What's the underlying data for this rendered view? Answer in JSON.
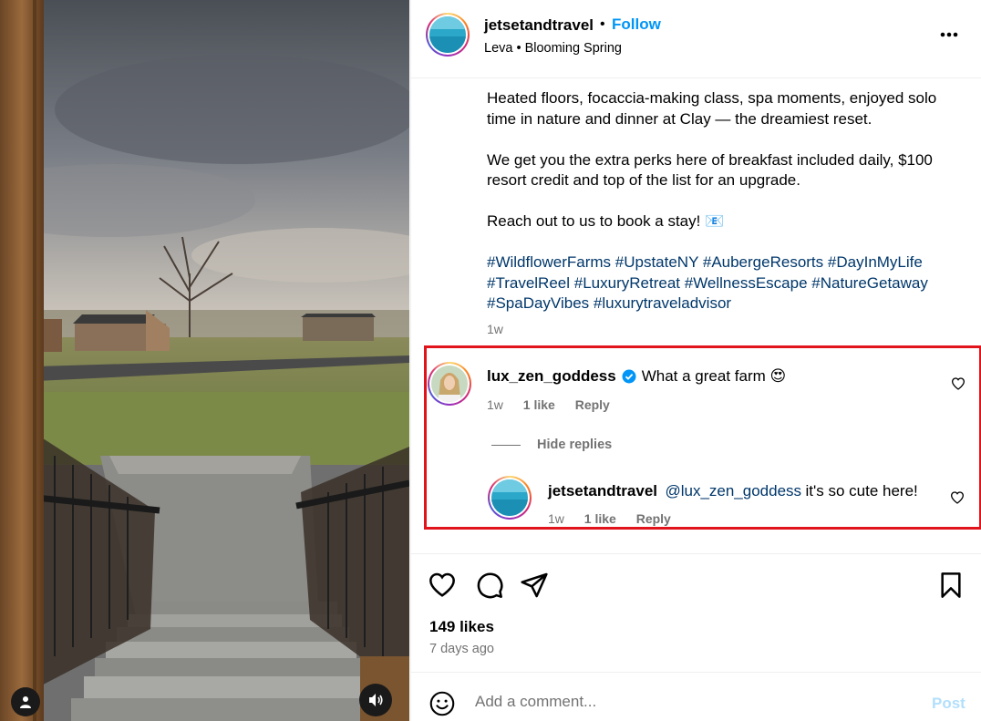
{
  "post": {
    "owner": "jetsetandtravel",
    "separator": "•",
    "follow_label": "Follow",
    "location": "Leva • Blooming Spring",
    "more_icon": "more-horizontal-icon"
  },
  "caption": {
    "paragraph1": "Heated floors, focaccia-making class, spa moments, enjoyed solo time in nature and dinner at Clay — the dreamiest reset.",
    "paragraph2": "We get you the extra perks here of breakfast included daily, $100 resort credit and top of the list for an upgrade.",
    "paragraph3": "Reach out to us to book a stay! 📧",
    "hashtags": [
      "#WildflowerFarms",
      "#UpstateNY",
      "#AubergeResorts",
      "#DayInMyLife",
      "#TravelReel",
      "#LuxuryRetreat",
      "#WellnessEscape",
      "#NatureGetaway",
      "#SpaDayVibes",
      "#luxurytraveladvisor"
    ],
    "time": "1w"
  },
  "comments": [
    {
      "user": "lux_zen_goddess",
      "verified": true,
      "text": "What a great farm 😍",
      "time": "1w",
      "likes": "1 like",
      "reply_label": "Reply"
    }
  ],
  "hide_replies_label": "Hide replies",
  "replies": [
    {
      "user": "jetsetandtravel",
      "mention": "@lux_zen_goddess",
      "text": "it's so cute here!",
      "time": "1w",
      "likes": "1 like",
      "reply_label": "Reply"
    }
  ],
  "actions": {
    "likes_count": "149 likes",
    "date": "7 days ago"
  },
  "comment_box": {
    "placeholder": "Add a comment...",
    "post_label": "Post"
  },
  "colors": {
    "link_blue": "#0095f6",
    "hashtag_blue": "#00376b",
    "secondary_text": "#737373",
    "highlight_red": "#e1141c",
    "post_disabled": "#b2dffc"
  }
}
